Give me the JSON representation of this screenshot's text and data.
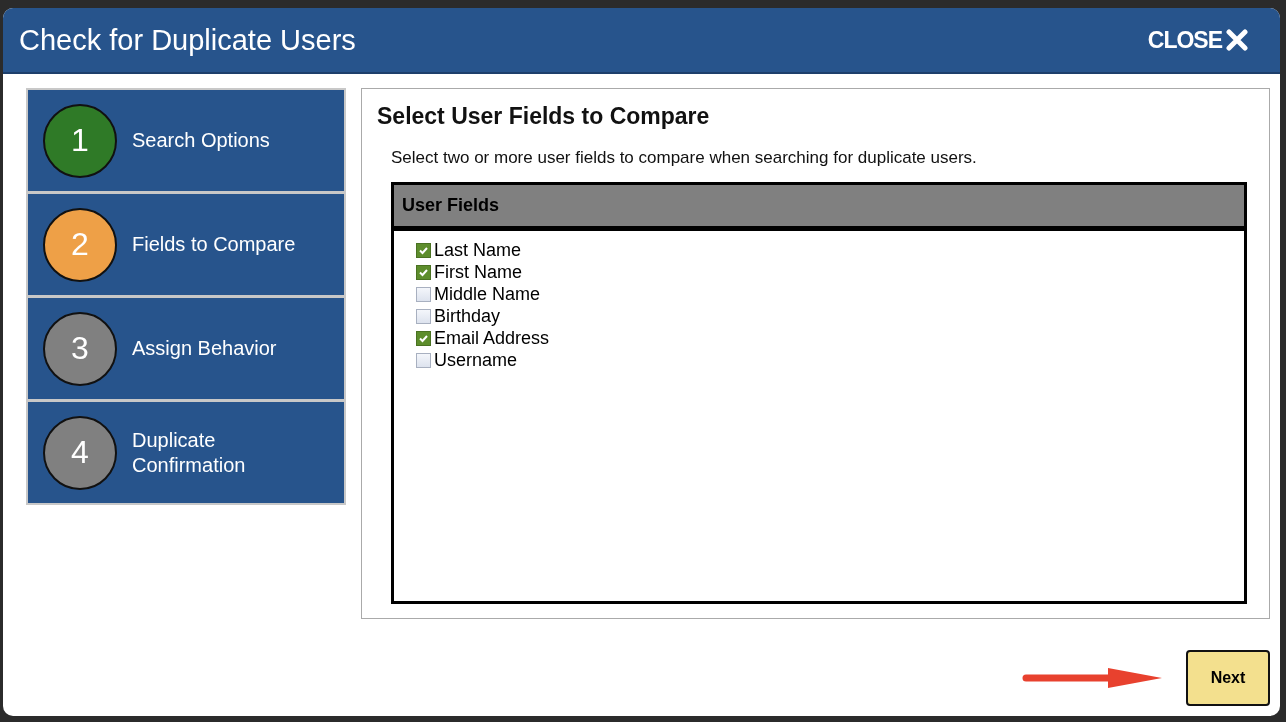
{
  "window": {
    "title": "Check for Duplicate Users",
    "close_label": "CLOSE"
  },
  "steps": [
    {
      "number": "1",
      "label": "Search Options",
      "kind": "done"
    },
    {
      "number": "2",
      "label": "Fields to Compare",
      "kind": "current"
    },
    {
      "number": "3",
      "label": "Assign Behavior",
      "kind": "pending"
    },
    {
      "number": "4",
      "label": "Duplicate Confirmation",
      "kind": "pending"
    }
  ],
  "panel": {
    "heading": "Select User Fields to Compare",
    "instruction": "Select two or more user fields to compare when searching for duplicate users.",
    "table": {
      "header": "User Fields",
      "fields": [
        {
          "label": "Last Name",
          "checked": true
        },
        {
          "label": "First Name",
          "checked": true
        },
        {
          "label": "Middle Name",
          "checked": false
        },
        {
          "label": "Birthday",
          "checked": false
        },
        {
          "label": "Email Address",
          "checked": true
        },
        {
          "label": "Username",
          "checked": false
        }
      ]
    }
  },
  "next_button": "Next"
}
